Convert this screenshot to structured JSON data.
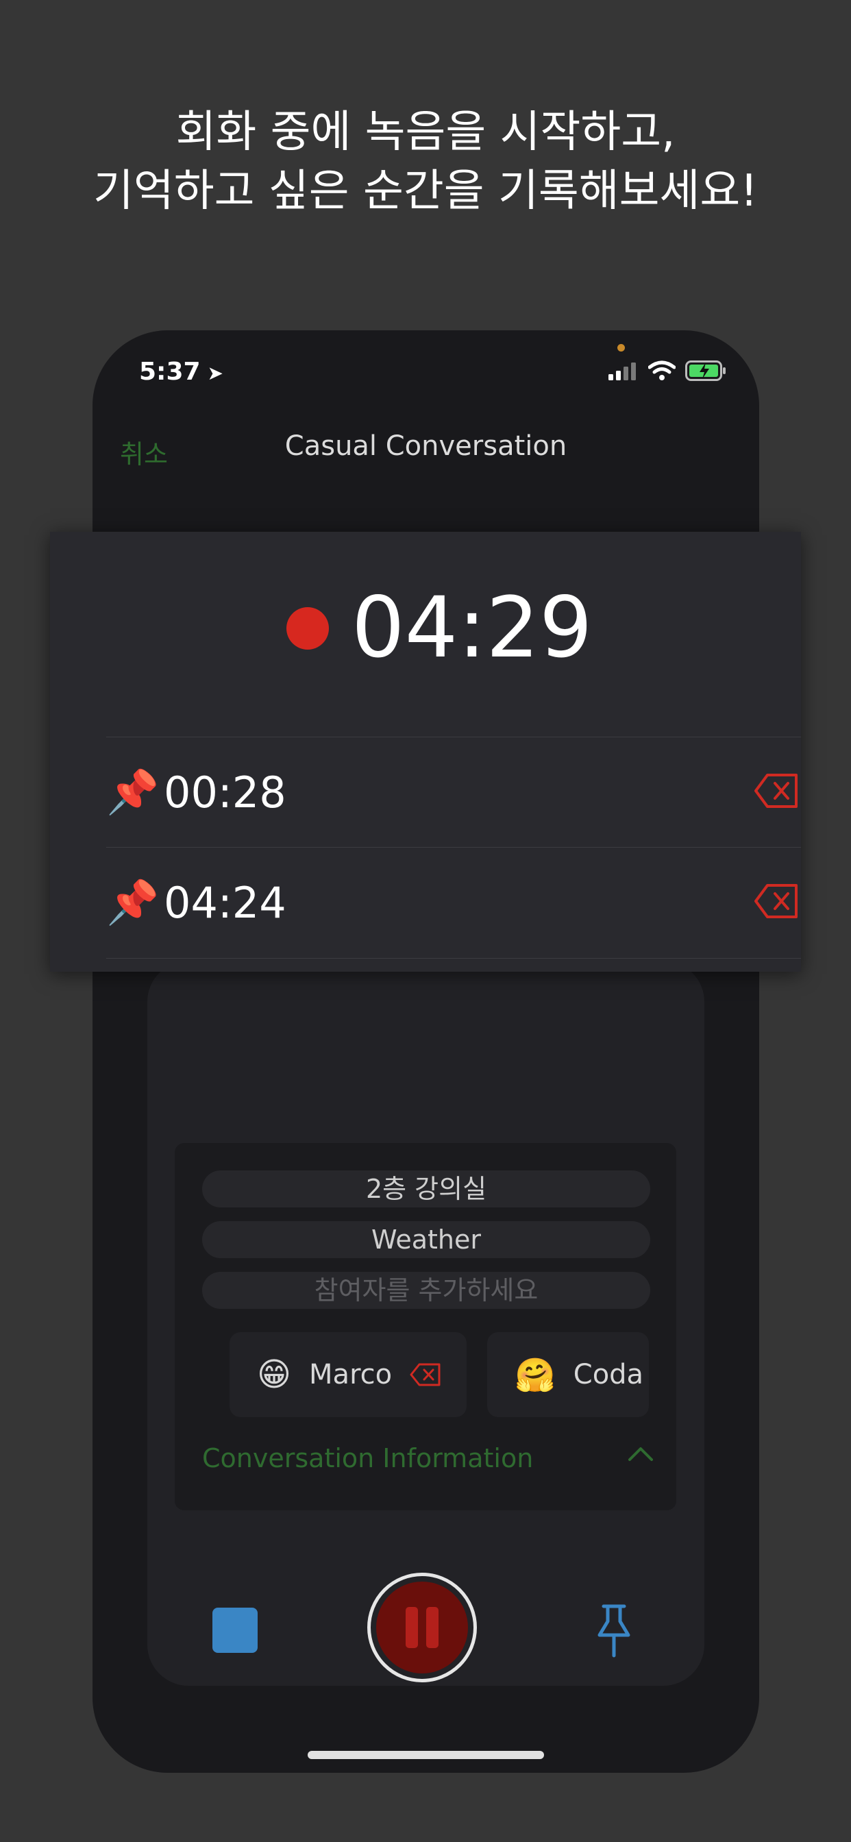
{
  "headline": {
    "line1": "회화 중에 녹음을 시작하고,",
    "line2": "기억하고 싶은 순간을 기록해보세요!"
  },
  "status_bar": {
    "time": "5:37",
    "location_icon": "location-arrow-icon",
    "icons": [
      "signal-icon",
      "wifi-icon",
      "battery-charging-icon"
    ]
  },
  "nav": {
    "cancel": "취소",
    "title": "Casual Conversation"
  },
  "recording": {
    "elapsed": "04:29",
    "marks": [
      {
        "emoji": "📌",
        "time": "00:28"
      },
      {
        "emoji": "📌",
        "time": "04:24"
      }
    ]
  },
  "info": {
    "location": "2층 강의실",
    "topic": "Weather",
    "participant_placeholder": "참여자를 추가하세요",
    "participants": [
      {
        "emoji": "😁",
        "name": "Marco"
      },
      {
        "emoji": "🤗",
        "name": "Coda"
      }
    ],
    "section_label": "Conversation Information"
  },
  "controls": {
    "stop_icon": "stop-icon",
    "pause_icon": "pause-icon",
    "pin_icon": "pushpin-icon"
  },
  "colors": {
    "accent_green": "#2e6b2e",
    "record_red": "#d7281f",
    "delete_red": "#d02a22",
    "stop_blue": "#3a86c5"
  }
}
